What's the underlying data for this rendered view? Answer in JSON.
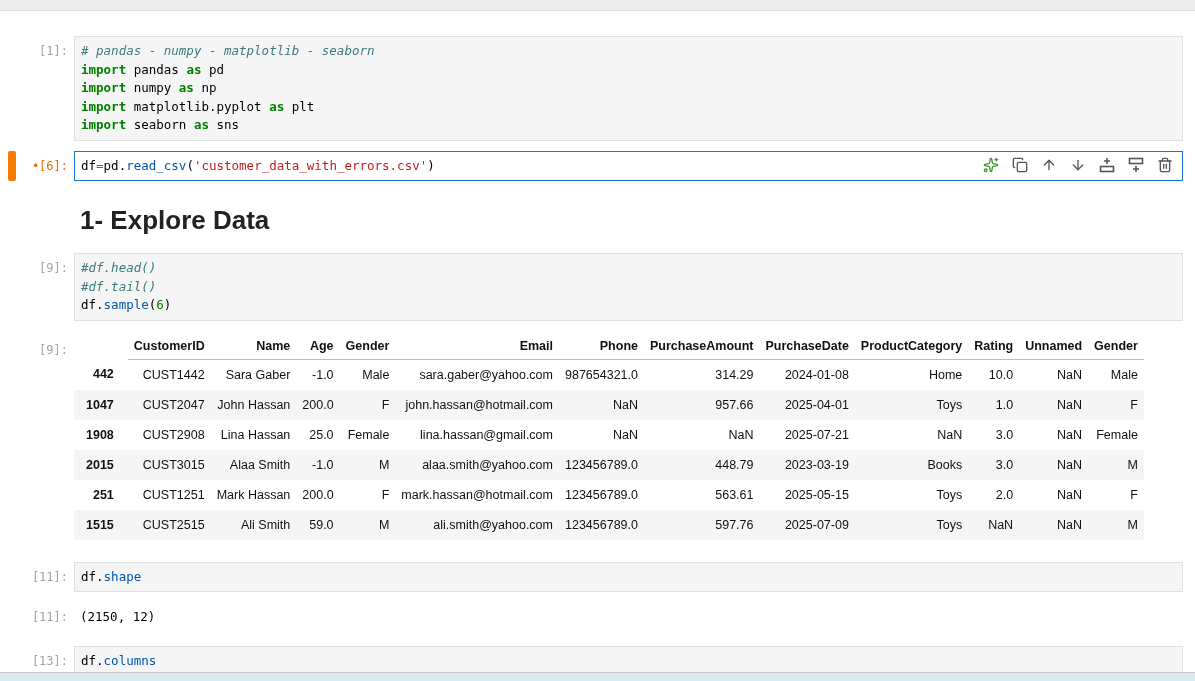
{
  "cells": [
    {
      "kind": "code",
      "prompt": "[1]:",
      "selected": false,
      "lines": [
        [
          {
            "kind": "comment",
            "text": "# pandas - numpy - matplotlib - seaborn"
          }
        ],
        [
          {
            "kind": "keyword",
            "text": "import"
          },
          {
            "kind": "plain",
            "text": " pandas "
          },
          {
            "kind": "keyword",
            "text": "as"
          },
          {
            "kind": "plain",
            "text": " pd"
          }
        ],
        [
          {
            "kind": "keyword",
            "text": "import"
          },
          {
            "kind": "plain",
            "text": " numpy "
          },
          {
            "kind": "keyword",
            "text": "as"
          },
          {
            "kind": "plain",
            "text": " np"
          }
        ],
        [
          {
            "kind": "keyword",
            "text": "import"
          },
          {
            "kind": "plain",
            "text": " matplotlib.pyplot "
          },
          {
            "kind": "keyword",
            "text": "as"
          },
          {
            "kind": "plain",
            "text": " plt"
          }
        ],
        [
          {
            "kind": "keyword",
            "text": "import"
          },
          {
            "kind": "plain",
            "text": " seaborn "
          },
          {
            "kind": "keyword",
            "text": "as"
          },
          {
            "kind": "plain",
            "text": " sns"
          }
        ]
      ]
    },
    {
      "kind": "code",
      "prompt": "•[6]:",
      "selected": true,
      "lines": [
        [
          {
            "kind": "plain",
            "text": "df"
          },
          {
            "kind": "operator",
            "text": "="
          },
          {
            "kind": "plain",
            "text": "pd."
          },
          {
            "kind": "attr",
            "text": "read_csv"
          },
          {
            "kind": "plain",
            "text": "("
          },
          {
            "kind": "string",
            "text": "'customer_data_with_errors.csv'"
          },
          {
            "kind": "plain",
            "text": ")"
          }
        ]
      ]
    },
    {
      "kind": "markdown",
      "selected": false,
      "heading": "1- Explore Data"
    },
    {
      "kind": "code",
      "prompt": "[9]:",
      "selected": false,
      "lines": [
        [
          {
            "kind": "comment",
            "text": "#df.head()"
          }
        ],
        [
          {
            "kind": "comment",
            "text": "#df.tail()"
          }
        ],
        [
          {
            "kind": "plain",
            "text": "df."
          },
          {
            "kind": "attr",
            "text": "sample"
          },
          {
            "kind": "plain",
            "text": "("
          },
          {
            "kind": "number",
            "text": "6"
          },
          {
            "kind": "plain",
            "text": ")"
          }
        ]
      ]
    },
    {
      "kind": "table",
      "prompt": "[9]:",
      "selected": false,
      "columns": [
        "CustomerID",
        "Name",
        "Age",
        "Gender",
        "Email",
        "Phone",
        "PurchaseAmount",
        "PurchaseDate",
        "ProductCategory",
        "Rating",
        "Unnamed",
        "Gender"
      ],
      "rows": [
        {
          "index": "442",
          "cells": [
            "CUST1442",
            "Sara Gaber",
            "-1.0",
            "Male",
            "sara.gaber@yahoo.com",
            "987654321.0",
            "314.29",
            "2024-01-08",
            "Home",
            "10.0",
            "NaN",
            "Male"
          ]
        },
        {
          "index": "1047",
          "cells": [
            "CUST2047",
            "John Hassan",
            "200.0",
            "F",
            "john.hassan@hotmail.com",
            "NaN",
            "957.66",
            "2025-04-01",
            "Toys",
            "1.0",
            "NaN",
            "F"
          ]
        },
        {
          "index": "1908",
          "cells": [
            "CUST2908",
            "Lina Hassan",
            "25.0",
            "Female",
            "lina.hassan@gmail.com",
            "NaN",
            "NaN",
            "2025-07-21",
            "NaN",
            "3.0",
            "NaN",
            "Female"
          ]
        },
        {
          "index": "2015",
          "cells": [
            "CUST3015",
            "Alaa Smith",
            "-1.0",
            "M",
            "alaa.smith@yahoo.com",
            "123456789.0",
            "448.79",
            "2023-03-19",
            "Books",
            "3.0",
            "NaN",
            "M"
          ]
        },
        {
          "index": "251",
          "cells": [
            "CUST1251",
            "Mark Hassan",
            "200.0",
            "F",
            "mark.hassan@hotmail.com",
            "123456789.0",
            "563.61",
            "2025-05-15",
            "Toys",
            "2.0",
            "NaN",
            "F"
          ]
        },
        {
          "index": "1515",
          "cells": [
            "CUST2515",
            "Ali Smith",
            "59.0",
            "M",
            "ali.smith@yahoo.com",
            "123456789.0",
            "597.76",
            "2025-07-09",
            "Toys",
            "NaN",
            "NaN",
            "M"
          ]
        }
      ]
    },
    {
      "kind": "code",
      "prompt": "[11]:",
      "selected": false,
      "lines": [
        [
          {
            "kind": "plain",
            "text": "df."
          },
          {
            "kind": "attr",
            "text": "shape"
          }
        ]
      ]
    },
    {
      "kind": "text",
      "prompt": "[11]:",
      "selected": false,
      "text": "(2150, 12)"
    },
    {
      "kind": "code",
      "prompt": "[13]:",
      "selected": false,
      "lines": [
        [
          {
            "kind": "plain",
            "text": "df."
          },
          {
            "kind": "attr",
            "text": "columns"
          }
        ]
      ]
    }
  ]
}
